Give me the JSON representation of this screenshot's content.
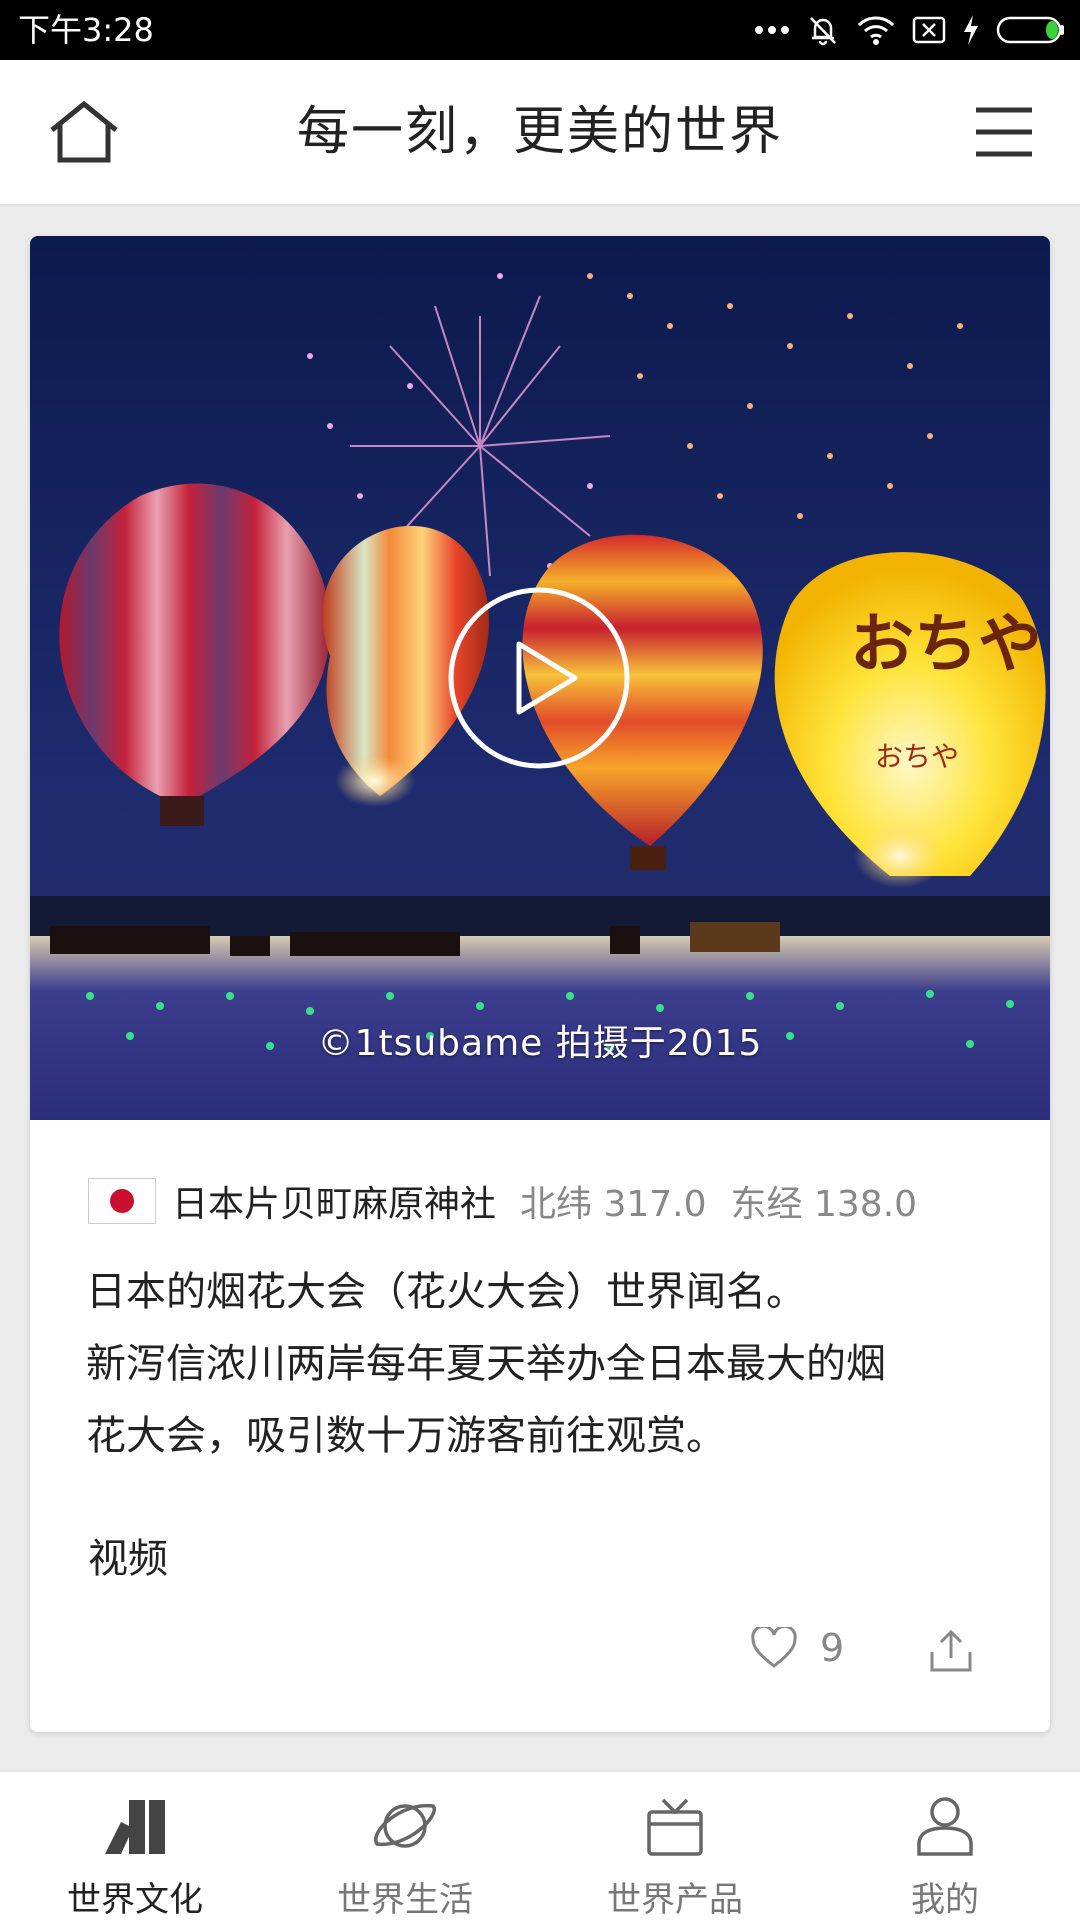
{
  "status_bar": {
    "time": "下午3:28"
  },
  "header": {
    "title": "每一刻，更美的世界"
  },
  "card": {
    "photo_credit": "©1tsubame 拍摄于2015",
    "location": {
      "name": "日本片贝町麻原神社",
      "lat": "北纬 317.0",
      "lng": "东经 138.0"
    },
    "description_lines": [
      "日本的烟花大会（花火大会）世界闻名。",
      "新泻信浓川两岸每年夏天举办全日本最大的烟",
      "花大会，吸引数十万游客前往观赏。"
    ],
    "tag": "视频",
    "likes": "9",
    "balloon_text_large": "おちや",
    "balloon_text_small": "おちや"
  },
  "tabs": [
    {
      "label": "世界文化",
      "icon": "books-icon",
      "active": true
    },
    {
      "label": "世界生活",
      "icon": "planet-icon",
      "active": false
    },
    {
      "label": "世界产品",
      "icon": "gift-box-icon",
      "active": false
    },
    {
      "label": "我的",
      "icon": "person-icon",
      "active": false
    }
  ],
  "colors": {
    "accent_text": "#222222",
    "muted_text": "#888888",
    "flag_red": "#c8102e"
  }
}
